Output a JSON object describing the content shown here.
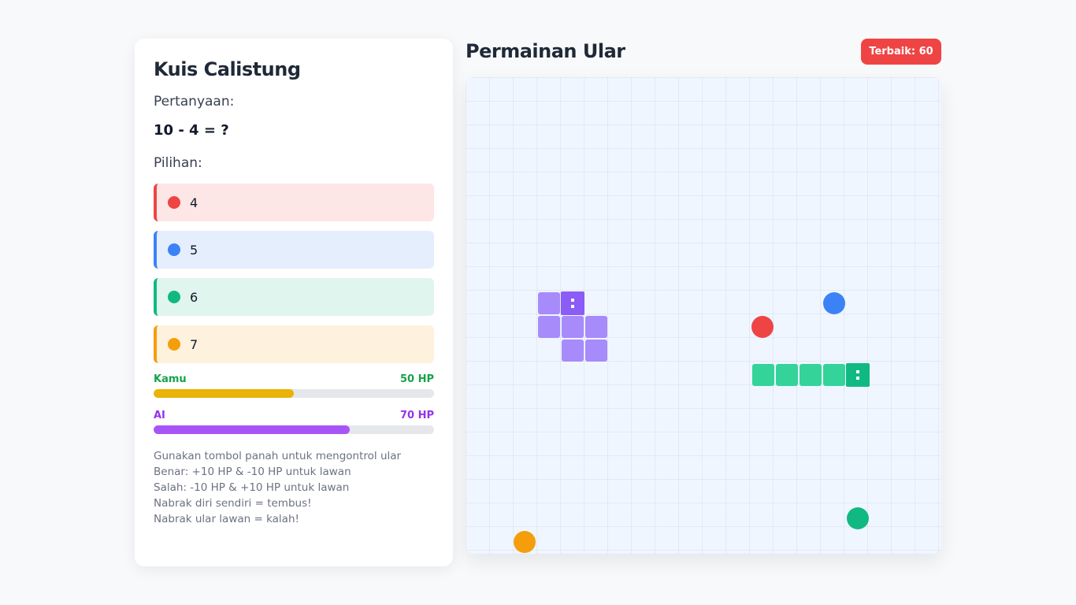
{
  "quiz": {
    "title": "Kuis Calistung",
    "question_label": "Pertanyaan:",
    "question": "10 - 4 = ?",
    "options_label": "Pilihan:",
    "options": [
      {
        "value": "4",
        "color": "#ef4444",
        "bg": "#fde6e6"
      },
      {
        "value": "5",
        "color": "#3b82f6",
        "bg": "#e5eefd"
      },
      {
        "value": "6",
        "color": "#10b981",
        "bg": "#e0f5ee"
      },
      {
        "value": "7",
        "color": "#f59e0b",
        "bg": "#fef1de"
      }
    ],
    "player": {
      "name": "Kamu",
      "hp_text": "50 HP",
      "hp_fraction": 0.5,
      "color": "#16a34a",
      "bar_color": "#eab308"
    },
    "ai": {
      "name": "AI",
      "hp_text": "70 HP",
      "hp_fraction": 0.7,
      "color": "#9333ea",
      "bar_color": "#a855f7"
    },
    "instructions": [
      "Gunakan tombol panah untuk mengontrol ular",
      "Benar: +10 HP & -10 HP untuk lawan",
      "Salah: -10 HP & +10 HP untuk lawan",
      "Nabrak diri sendiri = tembus!",
      "Nabrak ular lawan = kalah!"
    ]
  },
  "game": {
    "title": "Permainan Ular",
    "best_score": "Terbaik: 60",
    "colors": {
      "ai_snake_body": "#a78bfa",
      "ai_snake_head": "#8b5cf6",
      "player_snake_body": "#34d399",
      "player_snake_head": "#10b981"
    }
  }
}
